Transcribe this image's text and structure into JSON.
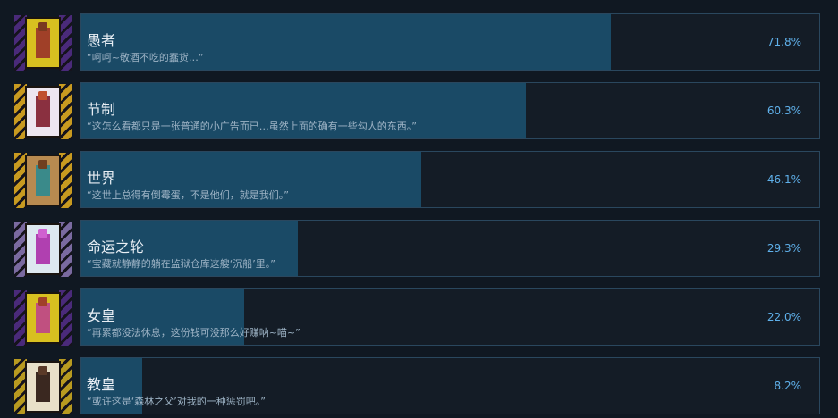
{
  "achievements": [
    {
      "title": "愚者",
      "quote": "“呵呵~敬酒不吃的蠢货…”",
      "percent_text": "71.8%",
      "percent": 71.8,
      "card_icon": "fool-card-icon",
      "card_colors": {
        "side": "#4a2a7a",
        "face": "#d8c020",
        "figure": "#a04028",
        "head": "#7a3a20"
      }
    },
    {
      "title": "节制",
      "quote": "“这怎么看都只是一张普通的小广告而已…虽然上面的确有一些勾人的东西。”",
      "percent_text": "60.3%",
      "percent": 60.3,
      "card_icon": "temperance-card-icon",
      "card_colors": {
        "side": "#c89a20",
        "face": "#ede6f0",
        "figure": "#8a3040",
        "head": "#c05030"
      }
    },
    {
      "title": "世界",
      "quote": "“这世上总得有倒霉蛋，不是他们，就是我们。”",
      "percent_text": "46.1%",
      "percent": 46.1,
      "card_icon": "world-card-icon",
      "card_colors": {
        "side": "#c89a20",
        "face": "#b88a50",
        "figure": "#3a8a8a",
        "head": "#704020"
      }
    },
    {
      "title": "命运之轮",
      "quote": "“宝藏就静静的躺在监狱仓库这艘‘沉船’里。”",
      "percent_text": "29.3%",
      "percent": 29.3,
      "card_icon": "wheel-of-fortune-card-icon",
      "card_colors": {
        "side": "#7a6aa0",
        "face": "#dde8f0",
        "figure": "#b040b0",
        "head": "#d060d0"
      }
    },
    {
      "title": "女皇",
      "quote": "“再累都没法休息，这份钱可没那么好赚呐~喵~”",
      "percent_text": "22.0%",
      "percent": 22.0,
      "card_icon": "empress-card-icon",
      "card_colors": {
        "side": "#4a2a7a",
        "face": "#d8c020",
        "figure": "#c05080",
        "head": "#a04028"
      }
    },
    {
      "title": "教皇",
      "quote": "“或许这是‘森林之父’对我的一种惩罚吧。”",
      "percent_text": "8.2%",
      "percent": 8.2,
      "card_icon": "hierophant-card-icon",
      "card_colors": {
        "side": "#b89a20",
        "face": "#e8e0c8",
        "figure": "#3a2820",
        "head": "#5a3a28"
      }
    }
  ]
}
